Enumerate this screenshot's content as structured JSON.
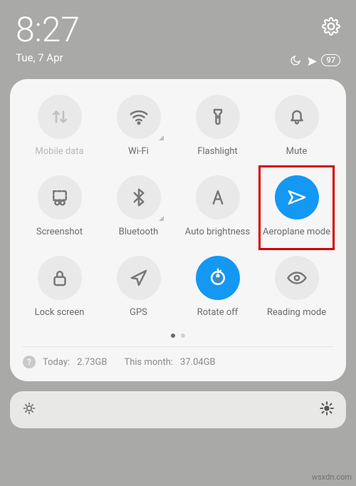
{
  "header": {
    "time": "8:27",
    "date": "Tue, 7 Apr",
    "battery": "97"
  },
  "tiles": [
    {
      "label": "Mobile data"
    },
    {
      "label": "Wi-Fi"
    },
    {
      "label": "Flashlight"
    },
    {
      "label": "Mute"
    },
    {
      "label": "Screenshot"
    },
    {
      "label": "Bluetooth"
    },
    {
      "label": "Auto brightness"
    },
    {
      "label": "Aeroplane mode"
    },
    {
      "label": "Lock screen"
    },
    {
      "label": "GPS"
    },
    {
      "label": "Rotate off"
    },
    {
      "label": "Reading mode"
    }
  ],
  "usage": {
    "today_label": "Today:",
    "today_value": "2.73GB",
    "month_label": "This month:",
    "month_value": "37.04GB"
  },
  "watermark": "wsxdn.com"
}
